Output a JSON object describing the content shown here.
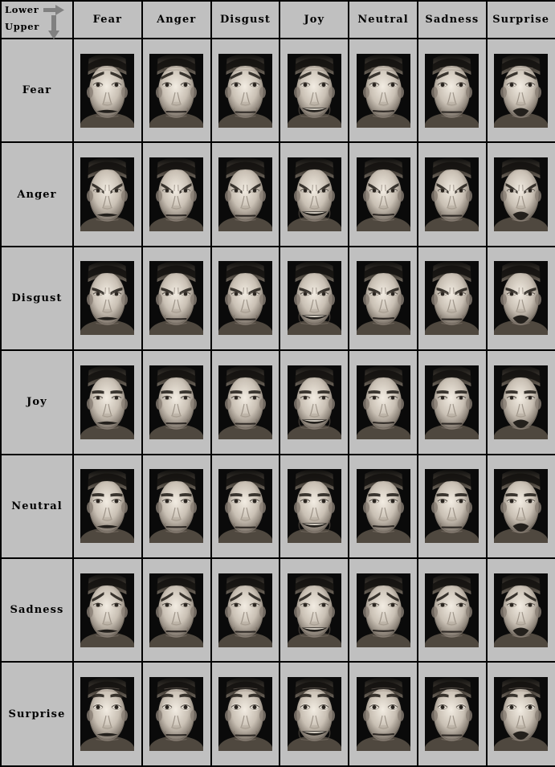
{
  "figure": {
    "kind": "composite-face-matrix",
    "corner": {
      "lower_label": "Lower",
      "upper_label": "Upper",
      "lower_arrow_icon": "arrow-right-icon",
      "upper_arrow_icon": "arrow-down-icon"
    },
    "column_header_meaning": "Lower",
    "row_header_meaning": "Upper",
    "columns": [
      "Fear",
      "Anger",
      "Disgust",
      "Joy",
      "Neutral",
      "Sadness",
      "Surprise"
    ],
    "rows": [
      "Fear",
      "Anger",
      "Disgust",
      "Joy",
      "Neutral",
      "Sadness",
      "Surprise"
    ],
    "colors": {
      "background": "#c0c0c0",
      "grid_line": "#000000",
      "arrow": "#808080",
      "text": "#000000",
      "photo_backdrop": "#0a0a0a"
    },
    "cells": [
      [
        {
          "upper": "Fear",
          "lower": "Fear"
        },
        {
          "upper": "Fear",
          "lower": "Anger"
        },
        {
          "upper": "Fear",
          "lower": "Disgust"
        },
        {
          "upper": "Fear",
          "lower": "Joy"
        },
        {
          "upper": "Fear",
          "lower": "Neutral"
        },
        {
          "upper": "Fear",
          "lower": "Sadness"
        },
        {
          "upper": "Fear",
          "lower": "Surprise"
        }
      ],
      [
        {
          "upper": "Anger",
          "lower": "Fear"
        },
        {
          "upper": "Anger",
          "lower": "Anger"
        },
        {
          "upper": "Anger",
          "lower": "Disgust"
        },
        {
          "upper": "Anger",
          "lower": "Joy"
        },
        {
          "upper": "Anger",
          "lower": "Neutral"
        },
        {
          "upper": "Anger",
          "lower": "Sadness"
        },
        {
          "upper": "Anger",
          "lower": "Surprise"
        }
      ],
      [
        {
          "upper": "Disgust",
          "lower": "Fear"
        },
        {
          "upper": "Disgust",
          "lower": "Anger"
        },
        {
          "upper": "Disgust",
          "lower": "Disgust"
        },
        {
          "upper": "Disgust",
          "lower": "Joy"
        },
        {
          "upper": "Disgust",
          "lower": "Neutral"
        },
        {
          "upper": "Disgust",
          "lower": "Sadness"
        },
        {
          "upper": "Disgust",
          "lower": "Surprise"
        }
      ],
      [
        {
          "upper": "Joy",
          "lower": "Fear"
        },
        {
          "upper": "Joy",
          "lower": "Anger"
        },
        {
          "upper": "Joy",
          "lower": "Disgust"
        },
        {
          "upper": "Joy",
          "lower": "Joy"
        },
        {
          "upper": "Joy",
          "lower": "Neutral"
        },
        {
          "upper": "Joy",
          "lower": "Sadness"
        },
        {
          "upper": "Joy",
          "lower": "Surprise"
        }
      ],
      [
        {
          "upper": "Neutral",
          "lower": "Fear"
        },
        {
          "upper": "Neutral",
          "lower": "Anger"
        },
        {
          "upper": "Neutral",
          "lower": "Disgust"
        },
        {
          "upper": "Neutral",
          "lower": "Joy"
        },
        {
          "upper": "Neutral",
          "lower": "Neutral"
        },
        {
          "upper": "Neutral",
          "lower": "Sadness"
        },
        {
          "upper": "Neutral",
          "lower": "Surprise"
        }
      ],
      [
        {
          "upper": "Sadness",
          "lower": "Fear"
        },
        {
          "upper": "Sadness",
          "lower": "Anger"
        },
        {
          "upper": "Sadness",
          "lower": "Disgust"
        },
        {
          "upper": "Sadness",
          "lower": "Joy"
        },
        {
          "upper": "Sadness",
          "lower": "Neutral"
        },
        {
          "upper": "Sadness",
          "lower": "Sadness"
        },
        {
          "upper": "Sadness",
          "lower": "Surprise"
        }
      ],
      [
        {
          "upper": "Surprise",
          "lower": "Fear"
        },
        {
          "upper": "Surprise",
          "lower": "Anger"
        },
        {
          "upper": "Surprise",
          "lower": "Disgust"
        },
        {
          "upper": "Surprise",
          "lower": "Joy"
        },
        {
          "upper": "Surprise",
          "lower": "Neutral"
        },
        {
          "upper": "Surprise",
          "lower": "Sadness"
        },
        {
          "upper": "Surprise",
          "lower": "Surprise"
        }
      ]
    ]
  }
}
